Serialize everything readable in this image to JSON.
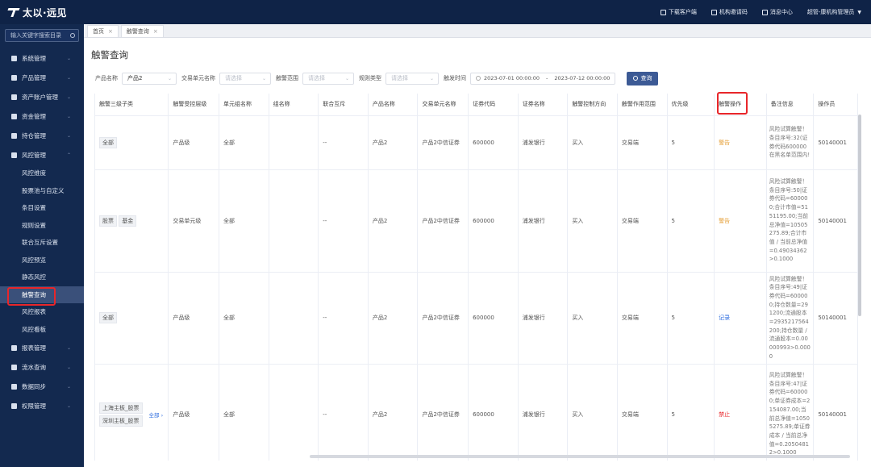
{
  "app": {
    "logo_text": "太以·远见"
  },
  "topbar": {
    "download_client": "下载客户端",
    "org_invite_code": "机构邀请码",
    "message_center": "消息中心",
    "user": "超管-康机构管理员"
  },
  "sidebar": {
    "search_placeholder": "输入关键字搜索目录",
    "menu": [
      {
        "label": "系统管理"
      },
      {
        "label": "产品管理"
      },
      {
        "label": "资产账户管理"
      },
      {
        "label": "资金管理"
      },
      {
        "label": "持仓管理"
      },
      {
        "label": "风控管理"
      }
    ],
    "risk_sub": [
      {
        "label": "风控维度"
      },
      {
        "label": "股票池与自定义"
      },
      {
        "label": "条目设置"
      },
      {
        "label": "规则设置"
      },
      {
        "label": "联合互斥设置"
      },
      {
        "label": "风控预览"
      },
      {
        "label": "静态风控"
      },
      {
        "label": "触警查询"
      },
      {
        "label": "风控报表"
      },
      {
        "label": "风控看板"
      }
    ],
    "menu_bottom": [
      {
        "label": "报表管理"
      },
      {
        "label": "流水查询"
      },
      {
        "label": "数据同步"
      },
      {
        "label": "权限管理"
      }
    ]
  },
  "tabs": [
    {
      "label": "首页"
    },
    {
      "label": "触警查询"
    }
  ],
  "page_title": "触警查询",
  "filters": {
    "product_label": "产品名称",
    "product_value": "产品2",
    "unit_label": "交易单元名称",
    "unit_placeholder": "请选择",
    "scope_label": "触警范围",
    "scope_placeholder": "请选择",
    "rule_type_label": "规则类型",
    "rule_type_placeholder": "请选择",
    "time_label": "触发时间",
    "time_start": "2023-07-01 00:00:00",
    "time_sep": "-",
    "time_end": "2023-07-12 00:00:00",
    "query_button": "查询"
  },
  "table": {
    "headers": [
      "触警三级子类",
      "触警受控层级",
      "单元组名称",
      "组名称",
      "联合互斥",
      "产品名称",
      "交易单元名称",
      "证券代码",
      "证券名称",
      "触警控制方向",
      "触警作用范围",
      "优先级",
      "触警操作",
      "备注信息",
      "操作员"
    ],
    "rows": [
      {
        "subcat_tags": [
          "全部"
        ],
        "level": "产品级",
        "unit_group": "全部",
        "group": "",
        "mutex": "--",
        "product": "产品2",
        "unit": "产品2中信证券",
        "code": "600000",
        "sec_name": "浦发银行",
        "direction": "买入",
        "scope": "交易端",
        "priority": "5",
        "op": "警告",
        "op_type": "warn",
        "note": "风险试算触警！条目序号:32(证券代码600000在黑名单范围内!",
        "operator": "50140001"
      },
      {
        "subcat_tags": [
          "股票",
          "基金"
        ],
        "level": "交易单元级",
        "unit_group": "全部",
        "group": "",
        "mutex": "--",
        "product": "产品2",
        "unit": "产品2中信证券",
        "code": "600000",
        "sec_name": "浦发银行",
        "direction": "买入",
        "scope": "交易端",
        "priority": "5",
        "op": "警告",
        "op_type": "warn",
        "note": "风险试算触警！条目序号:50|证券代码=600000;合计市值=5151195.00;当前总净值=10505275.89;合计市值 / 当前总净值=0.49034362>0.1000",
        "operator": "50140001"
      },
      {
        "subcat_tags": [
          "全部"
        ],
        "level": "产品级",
        "unit_group": "全部",
        "group": "",
        "mutex": "--",
        "product": "产品2",
        "unit": "产品2中信证券",
        "code": "600000",
        "sec_name": "浦发银行",
        "direction": "买入",
        "scope": "交易端",
        "priority": "5",
        "op": "记录",
        "op_type": "record",
        "note": "风险试算触警！条目序号:49|证券代码=600000;持仓数量=291200;流通股本=2935217564200;持仓数量 / 流通股本=0.00000993>0.0000",
        "operator": "50140001"
      },
      {
        "subcat_tags": [
          "上海主板_股票",
          "深圳主板_股票"
        ],
        "subcat_more": "全部 ›",
        "level": "产品级",
        "unit_group": "全部",
        "group": "",
        "mutex": "--",
        "product": "产品2",
        "unit": "产品2中信证券",
        "code": "600000",
        "sec_name": "浦发银行",
        "direction": "买入",
        "scope": "交易端",
        "priority": "5",
        "op": "禁止",
        "op_type": "ban",
        "note": "风险试算触警！条目序号:47|证券代码=600000;单证券成本=2154087.00;当前总净值=10505275.89;单证券成本 / 当前总净值=0.20504812>0.1000",
        "operator": "50140001"
      }
    ]
  }
}
